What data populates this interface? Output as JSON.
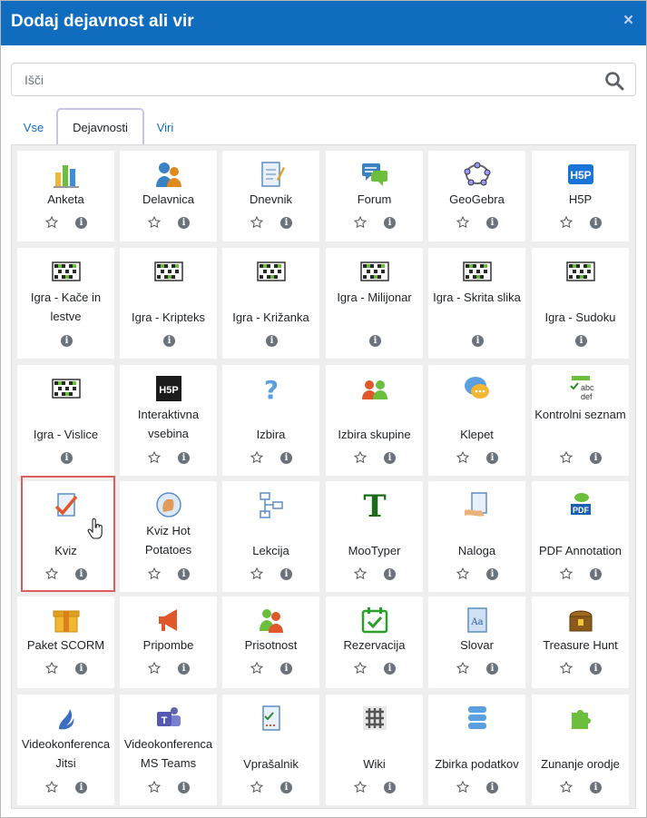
{
  "modal": {
    "title": "Dodaj dejavnost ali vir",
    "close_glyph": "×"
  },
  "search": {
    "placeholder": "Išči"
  },
  "tabs": [
    {
      "label": "Vse"
    },
    {
      "label": "Dejavnosti"
    },
    {
      "label": "Viri"
    }
  ],
  "items": [
    {
      "label": "Anketa",
      "icon": "bar-chart-icon",
      "star": true
    },
    {
      "label": "Delavnica",
      "icon": "people-icon",
      "star": true
    },
    {
      "label": "Dnevnik",
      "icon": "journal-icon",
      "star": true
    },
    {
      "label": "Forum",
      "icon": "forum-icon",
      "star": true
    },
    {
      "label": "GeoGebra",
      "icon": "geogebra-icon",
      "star": true
    },
    {
      "label": "H5P",
      "icon": "h5p-icon",
      "star": true
    },
    {
      "label": "Igra - Kače in lestve",
      "icon": "game-grid-icon",
      "star": false
    },
    {
      "label": "Igra - Kripteks",
      "icon": "game-grid-icon",
      "star": false
    },
    {
      "label": "Igra - Križanka",
      "icon": "game-grid-icon",
      "star": false
    },
    {
      "label": "Igra - Milijonar",
      "icon": "game-grid-icon",
      "star": false
    },
    {
      "label": "Igra - Skrita slika",
      "icon": "game-grid-icon",
      "star": false
    },
    {
      "label": "Igra - Sudoku",
      "icon": "game-grid-icon",
      "star": false
    },
    {
      "label": "Igra - Vislice",
      "icon": "game-grid-icon",
      "star": false
    },
    {
      "label": "Interaktivna vsebina",
      "icon": "h5p-dark-icon",
      "star": true
    },
    {
      "label": "Izbira",
      "icon": "question-icon",
      "star": true
    },
    {
      "label": "Izbira skupine",
      "icon": "group-choice-icon",
      "star": true
    },
    {
      "label": "Klepet",
      "icon": "chat-icon",
      "star": true
    },
    {
      "label": "Kontrolni seznam",
      "icon": "checklist-icon",
      "star": true
    },
    {
      "label": "Kviz",
      "icon": "quiz-icon",
      "star": true
    },
    {
      "label": "Kviz Hot Potatoes",
      "icon": "hotpot-icon",
      "star": true
    },
    {
      "label": "Lekcija",
      "icon": "lesson-icon",
      "star": true
    },
    {
      "label": "MooTyper",
      "icon": "mootyper-icon",
      "star": true
    },
    {
      "label": "Naloga",
      "icon": "assignment-icon",
      "star": true
    },
    {
      "label": "PDF Annotation",
      "icon": "pdf-icon",
      "star": true
    },
    {
      "label": "Paket SCORM",
      "icon": "scorm-icon",
      "star": true
    },
    {
      "label": "Pripombe",
      "icon": "megaphone-icon",
      "star": true
    },
    {
      "label": "Prisotnost",
      "icon": "attendance-icon",
      "star": true
    },
    {
      "label": "Rezervacija",
      "icon": "calendar-check-icon",
      "star": true
    },
    {
      "label": "Slovar",
      "icon": "glossary-icon",
      "star": true
    },
    {
      "label": "Treasure Hunt",
      "icon": "treasure-icon",
      "star": true
    },
    {
      "label": "Videokonferenca Jitsi",
      "icon": "jitsi-icon",
      "star": true
    },
    {
      "label": "Videokonferenca MS Teams",
      "icon": "teams-icon",
      "star": true
    },
    {
      "label": "Vprašalnik",
      "icon": "questionnaire-icon",
      "star": true
    },
    {
      "label": "Wiki",
      "icon": "wiki-icon",
      "star": true
    },
    {
      "label": "Zbirka podatkov",
      "icon": "database-icon",
      "star": true
    },
    {
      "label": "Zunanje orodje",
      "icon": "puzzle-icon",
      "star": true
    }
  ],
  "info_glyph": "i",
  "colors": {
    "header": "#0f6cbf",
    "link": "#0f6cbf",
    "highlight": "#e05b5b"
  }
}
